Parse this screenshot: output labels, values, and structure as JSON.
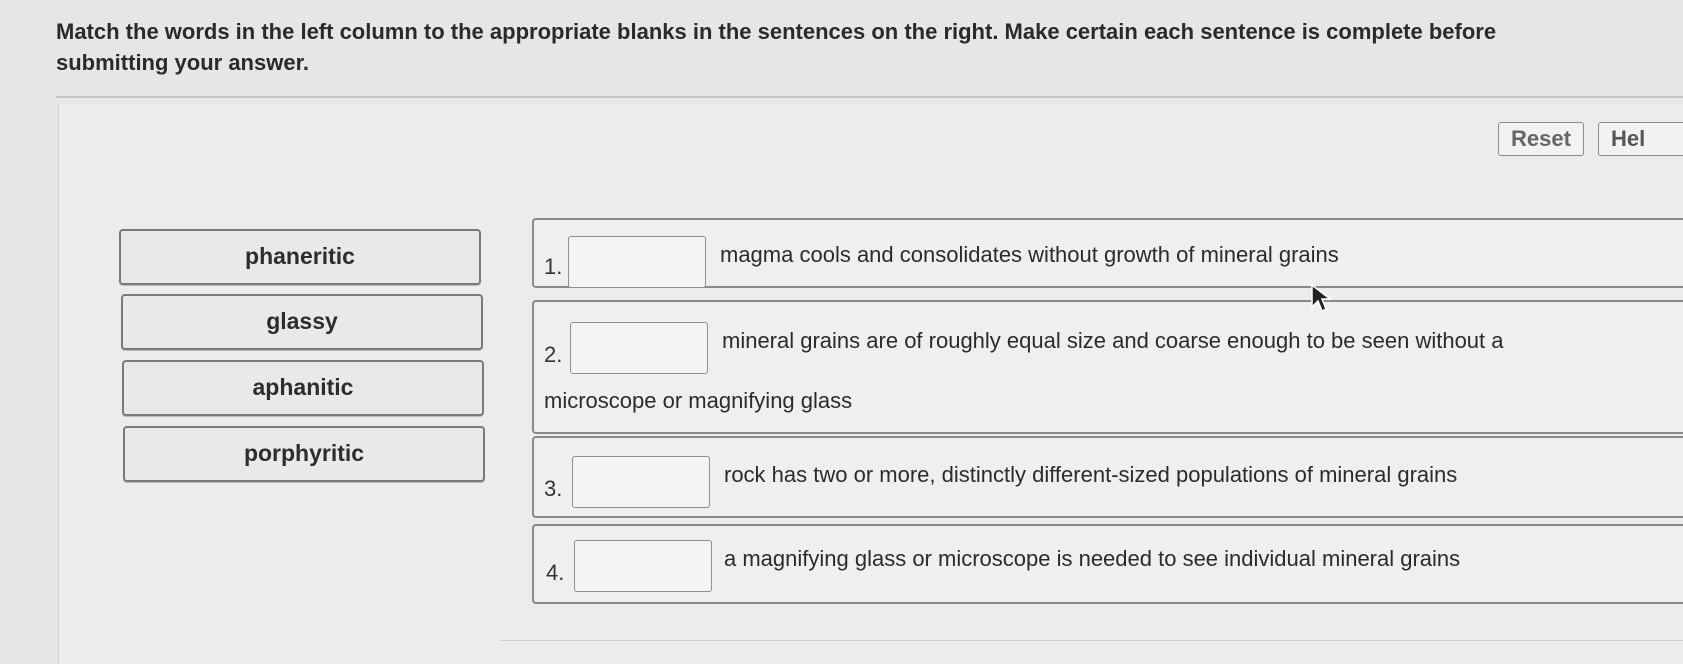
{
  "instructions": "Match the words in the left column to the appropriate blanks in the sentences on the right. Make certain each sentence is complete before submitting your answer.",
  "toolbar": {
    "reset_label": "Reset",
    "help_label": "Hel"
  },
  "words": [
    "phaneritic",
    "glassy",
    "aphanitic",
    "porphyritic"
  ],
  "sentences": [
    {
      "number": "1.",
      "text": "magma cools and consolidates without growth of mineral grains",
      "text2": ""
    },
    {
      "number": "2.",
      "text": "mineral grains are of roughly equal size and coarse enough to be seen without a",
      "text2": "microscope or magnifying glass"
    },
    {
      "number": "3.",
      "text": "rock has two or more, distinctly different-sized populations of mineral grains",
      "text2": ""
    },
    {
      "number": "4.",
      "text": "a magnifying glass or microscope is needed to see individual mineral grains",
      "text2": ""
    }
  ]
}
